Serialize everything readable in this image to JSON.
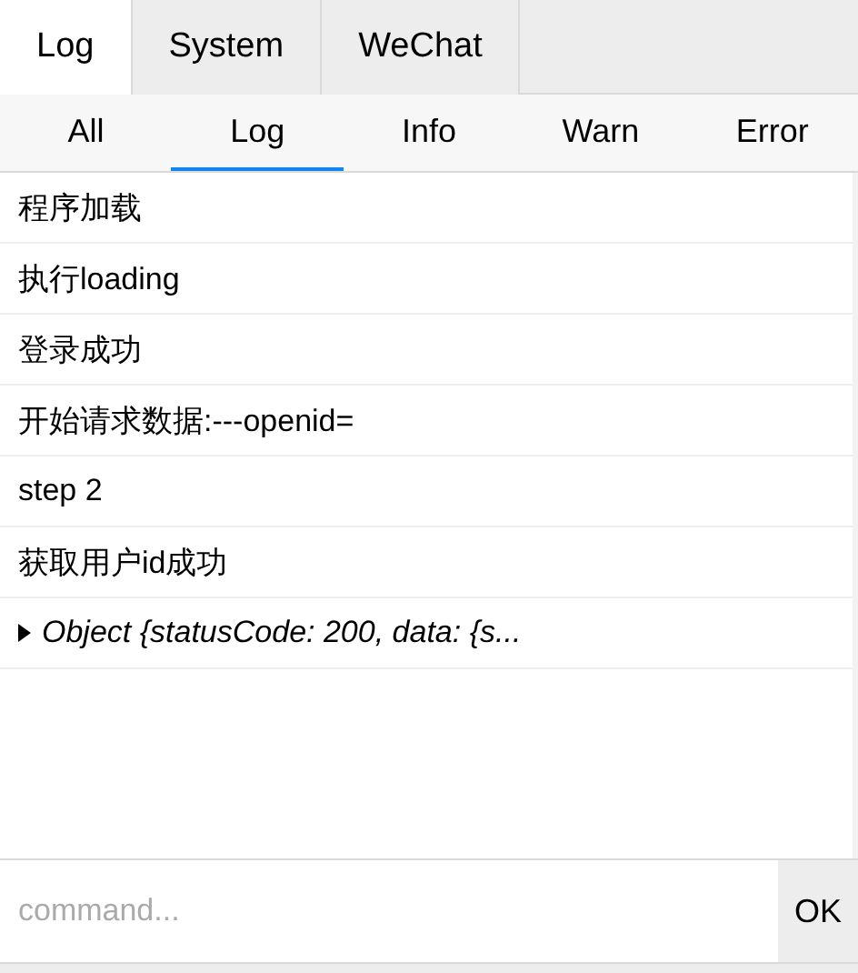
{
  "tabs": [
    {
      "label": "Log",
      "selected": true
    },
    {
      "label": "System",
      "selected": false
    },
    {
      "label": "WeChat",
      "selected": false
    }
  ],
  "filters": [
    {
      "label": "All",
      "selected": false
    },
    {
      "label": "Log",
      "selected": true
    },
    {
      "label": "Info",
      "selected": false
    },
    {
      "label": "Warn",
      "selected": false
    },
    {
      "label": "Error",
      "selected": false
    }
  ],
  "logs": [
    {
      "kind": "text",
      "text": "程序加载"
    },
    {
      "kind": "text",
      "text": "执行loading"
    },
    {
      "kind": "text",
      "text": "登录成功"
    },
    {
      "kind": "text",
      "text": "开始请求数据:---openid="
    },
    {
      "kind": "text",
      "text": "step 2"
    },
    {
      "kind": "text",
      "text": "获取用户id成功"
    },
    {
      "kind": "object",
      "text": "Object {statusCode: 200, data: {s...",
      "expanded": false
    }
  ],
  "command": {
    "placeholder": "command...",
    "button": "OK"
  }
}
